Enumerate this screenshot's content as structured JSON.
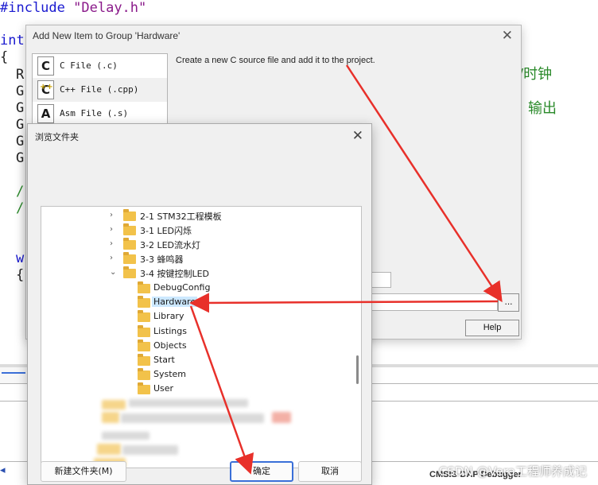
{
  "editor": {
    "include_keyword": "#include",
    "include_file": "\"Delay.h\"",
    "code_int": "int",
    "code_brace1": "{",
    "code_lines": [
      "R",
      "G",
      "G",
      "G",
      "G",
      "G"
    ],
    "code_comment1": "/",
    "code_comment2": "/",
    "code_w": "w",
    "code_brace2": "{",
    "cn_text_1": "/时钟",
    "cn_text_2": "输出",
    "debugger_label": "CMSIS-DAP Debugger",
    "left_marker": "◂"
  },
  "add_dialog": {
    "title": "Add New Item to Group 'Hardware'",
    "close_icon": "close-icon",
    "file_types": [
      {
        "icon": "C",
        "label": "C File (.c)"
      },
      {
        "icon": "C",
        "label": "C++ File (.cpp)"
      },
      {
        "icon": "A",
        "label": "Asm File (.s)"
      }
    ],
    "description": "Create a new C source file and add it to the project.",
    "browse_label": "...",
    "help_label": "Help"
  },
  "browse_dialog": {
    "title": "浏览文件夹",
    "close_icon": "close-icon",
    "tree": [
      {
        "label": "2-1 STM32工程模板",
        "expand": "›"
      },
      {
        "label": "3-1 LED闪烁",
        "expand": "›"
      },
      {
        "label": "3-2 LED流水灯",
        "expand": "›"
      },
      {
        "label": "3-3 蜂鸣器",
        "expand": "›"
      },
      {
        "label": "3-4 按键控制LED",
        "expand": "⌄"
      },
      {
        "label": "DebugConfig"
      },
      {
        "label": "Hardware",
        "selected": true
      },
      {
        "label": "Library"
      },
      {
        "label": "Listings"
      },
      {
        "label": "Objects"
      },
      {
        "label": "Start"
      },
      {
        "label": "System"
      },
      {
        "label": "User"
      }
    ],
    "new_folder_label": "新建文件夹(M)",
    "ok_label": "确定",
    "cancel_label": "取消"
  },
  "watermark": "CSDN @Vera工程师养成记",
  "colors": {
    "arrow": "#e8302a",
    "selection": "#cce8ff",
    "folder": "#f2c24a",
    "keyword": "#1a1ad0",
    "comment": "#2a8a2a"
  }
}
